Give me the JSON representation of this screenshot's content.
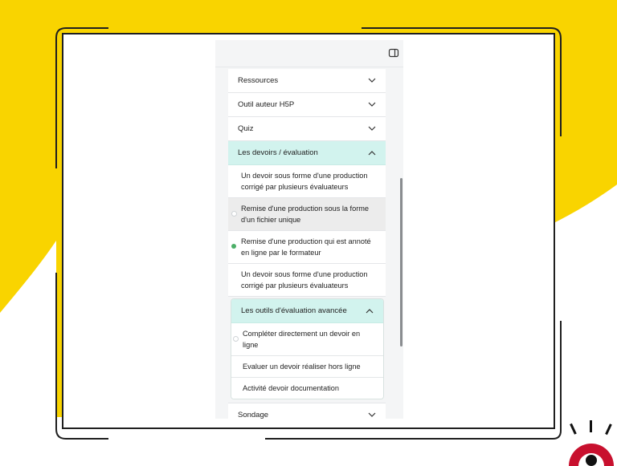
{
  "colors": {
    "accent_yellow": "#f9d400",
    "frame_dark": "#1f1f1f",
    "active_header": "#d2f3ee",
    "done_dot": "#4caf68",
    "logo_red": "#c8102e"
  },
  "panel": {
    "toggle_icon": "sidebar-toggle-icon"
  },
  "sections": [
    {
      "label": "Ressources"
    },
    {
      "label": "Outil auteur H5P"
    },
    {
      "label": "Quiz"
    },
    {
      "label": "Les devoirs / évaluation",
      "items": [
        {
          "label": "Un devoir sous forme d'une production corrigé par plusieurs évaluateurs",
          "status": "none"
        },
        {
          "label": "Remise d'une production sous la forme d'un fichier unique",
          "status": "incomplete"
        },
        {
          "label": "Remise d'une production qui est annoté en ligne par le formateur",
          "status": "complete"
        },
        {
          "label": "Un devoir sous forme d'une production corrigé par plusieurs évaluateurs",
          "status": "none"
        }
      ],
      "subsection": {
        "label": "Les outils d'évaluation avancée",
        "items": [
          {
            "label": "Compléter directement un devoir en ligne",
            "status": "incomplete"
          },
          {
            "label": "Evaluer un devoir réaliser hors ligne",
            "status": "none"
          },
          {
            "label": "Activité devoir documentation",
            "status": "none"
          }
        ]
      }
    },
    {
      "label": "Sondage"
    }
  ]
}
